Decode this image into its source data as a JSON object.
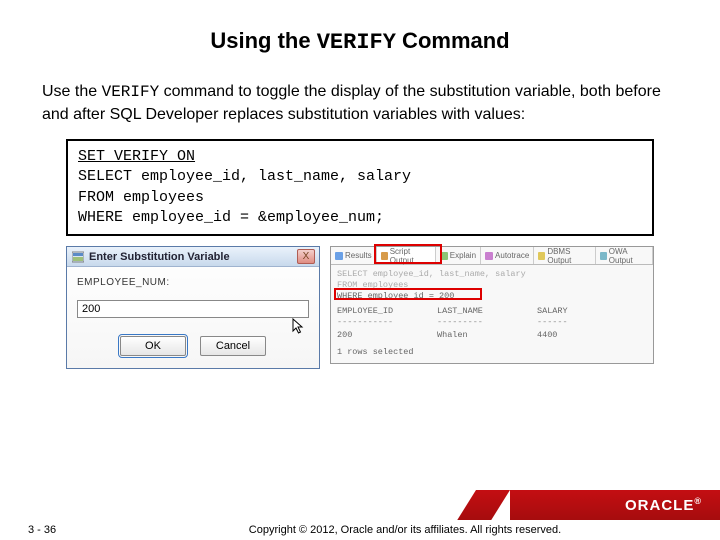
{
  "title_pre": "Using the ",
  "title_mono": "VERIFY",
  "title_post": " Command",
  "body_pre": "Use the ",
  "body_mono": "VERIFY",
  "body_post": " command to toggle the display of the substitution variable, both before and after SQL Developer replaces substitution variables with values:",
  "code": {
    "l1": "SET VERIFY ON",
    "l2": "SELECT employee_id, last_name, salary",
    "l3": "FROM   employees",
    "l4": "WHERE  employee_id = &employee_num;"
  },
  "dialog": {
    "title": "Enter Substitution Variable",
    "close": "X",
    "label": "EMPLOYEE_NUM:",
    "value": "200",
    "ok": "OK",
    "cancel": "Cancel"
  },
  "output": {
    "tabs": [
      "Results",
      "Script Output",
      "Explain",
      "Autotrace",
      "DBMS Output",
      "OWA Output"
    ],
    "l1_dim": "SELECT employee_id, last_name, salary",
    "l2_dim": "FROM   employees",
    "l3": "WHERE  employee_id = 200",
    "hdr_a": "EMPLOYEE_ID",
    "hdr_b": "LAST_NAME",
    "hdr_c": "SALARY",
    "val_a": "200",
    "val_b": "Whalen",
    "val_c": "4400",
    "footer": "1 rows selected"
  },
  "brand": "ORACLE",
  "page": "3 - 36",
  "copyright": "Copyright © 2012, Oracle and/or its affiliates. All rights reserved."
}
